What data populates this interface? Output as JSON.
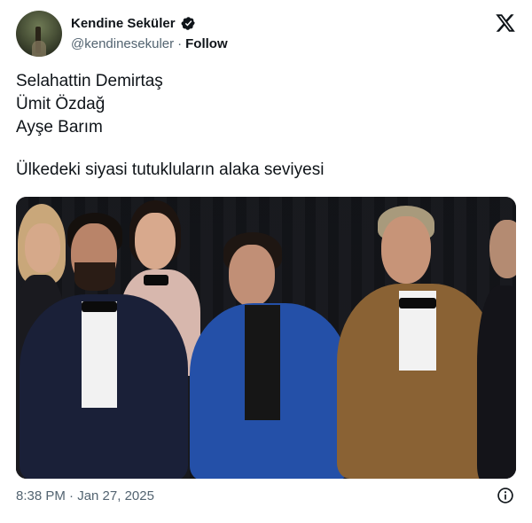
{
  "author": {
    "display_name": "Kendine Seküler",
    "handle": "@kendinesekuler",
    "separator": "·",
    "follow_label": "Follow",
    "verified": true,
    "verified_color": "#1d9bf0"
  },
  "platform_icon": "x-logo-icon",
  "tweet": {
    "lines": [
      "Selahattin Demirtaş",
      "Ümit Özdağ",
      "Ayşe Barım",
      "",
      "Ülkedeki siyasi tutukluların alaka seviyesi"
    ]
  },
  "media": {
    "type": "photo",
    "alt": ""
  },
  "footer": {
    "timestamp": "8:38 PM · Jan 27, 2025",
    "info_icon": "info-icon"
  },
  "colors": {
    "text_primary": "#0f1419",
    "text_secondary": "#536471",
    "background": "#ffffff"
  }
}
